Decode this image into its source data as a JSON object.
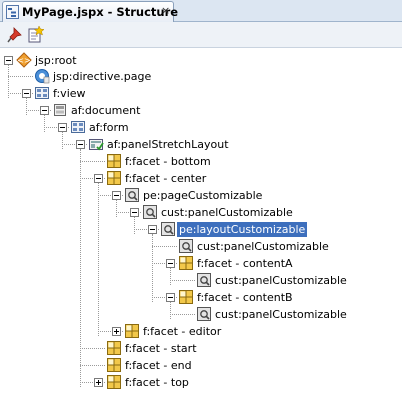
{
  "tab": {
    "title": "MyPage.jspx - Structure",
    "close": "×"
  },
  "toolbar": {
    "pin_icon": "pin-icon",
    "new_icon": "new-item-icon"
  },
  "tree": [
    {
      "label": "jsp:root",
      "icon": "xml-tag"
    },
    {
      "label": "jsp:directive.page",
      "icon": "jsp-directive"
    },
    {
      "label": "f:view",
      "icon": "component-grid"
    },
    {
      "label": "af:document",
      "icon": "document"
    },
    {
      "label": "af:form",
      "icon": "component-grid"
    },
    {
      "label": "af:panelStretchLayout",
      "icon": "panel-layout"
    },
    {
      "label": "f:facet - bottom",
      "icon": "facet"
    },
    {
      "label": "f:facet - center",
      "icon": "facet"
    },
    {
      "label": "pe:pageCustomizable",
      "icon": "customizable"
    },
    {
      "label": "cust:panelCustomizable",
      "icon": "customizable"
    },
    {
      "label": "pe:layoutCustomizable",
      "icon": "customizable",
      "selected": true
    },
    {
      "label": "cust:panelCustomizable",
      "icon": "customizable"
    },
    {
      "label": "f:facet - contentA",
      "icon": "facet"
    },
    {
      "label": "cust:panelCustomizable",
      "icon": "customizable"
    },
    {
      "label": "f:facet - contentB",
      "icon": "facet"
    },
    {
      "label": "cust:panelCustomizable",
      "icon": "customizable"
    },
    {
      "label": "f:facet - editor",
      "icon": "facet"
    },
    {
      "label": "f:facet - start",
      "icon": "facet"
    },
    {
      "label": "f:facet - end",
      "icon": "facet"
    },
    {
      "label": "f:facet - top",
      "icon": "facet"
    }
  ]
}
